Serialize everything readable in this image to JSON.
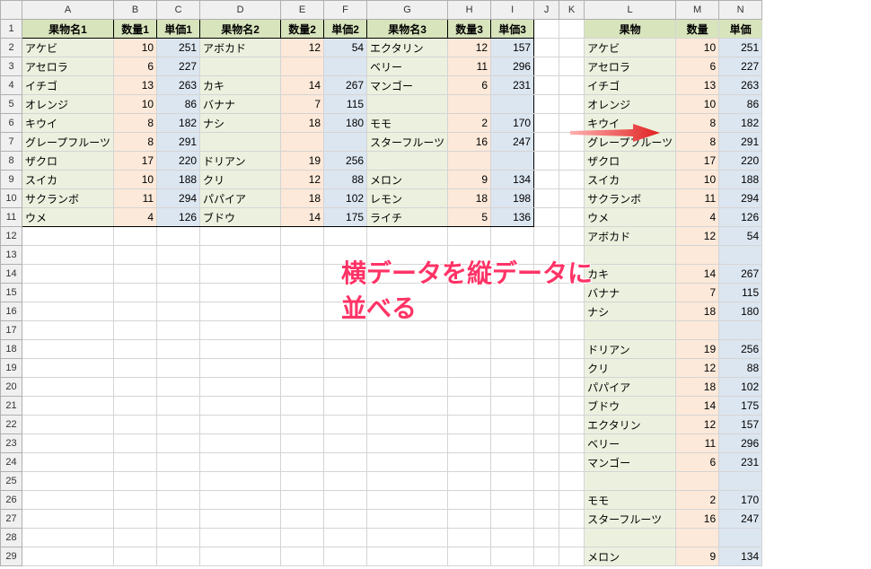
{
  "cols": [
    "A",
    "B",
    "C",
    "D",
    "E",
    "F",
    "G",
    "H",
    "I",
    "J",
    "K",
    "L",
    "M",
    "N"
  ],
  "widths": [
    90,
    48,
    48,
    90,
    48,
    48,
    90,
    48,
    48,
    28,
    28,
    90,
    48,
    48
  ],
  "headers1": {
    "A": "果物名1",
    "B": "数量1",
    "C": "単価1",
    "D": "果物名2",
    "E": "数量2",
    "F": "単価2",
    "G": "果物名3",
    "H": "数量3",
    "I": "単価3"
  },
  "headersR": {
    "L": "果物",
    "M": "数量",
    "N": "単価"
  },
  "left": [
    {
      "a": "アケビ",
      "b": 10,
      "c": 251,
      "d": "アボカド",
      "e": 12,
      "f": 54,
      "g": "エクタリン",
      "h": 12,
      "i": 157
    },
    {
      "a": "アセロラ",
      "b": 6,
      "c": 227,
      "d": "",
      "e": "",
      "f": "",
      "g": "ベリー",
      "h": 11,
      "i": 296
    },
    {
      "a": "イチゴ",
      "b": 13,
      "c": 263,
      "d": "カキ",
      "e": 14,
      "f": 267,
      "g": "マンゴー",
      "h": 6,
      "i": 231
    },
    {
      "a": "オレンジ",
      "b": 10,
      "c": 86,
      "d": "バナナ",
      "e": 7,
      "f": 115,
      "g": "",
      "h": "",
      "i": ""
    },
    {
      "a": "キウイ",
      "b": 8,
      "c": 182,
      "d": "ナシ",
      "e": 18,
      "f": 180,
      "g": "モモ",
      "h": 2,
      "i": 170
    },
    {
      "a": "グレープフルーツ",
      "b": 8,
      "c": 291,
      "d": "",
      "e": "",
      "f": "",
      "g": "スターフルーツ",
      "h": 16,
      "i": 247
    },
    {
      "a": "ザクロ",
      "b": 17,
      "c": 220,
      "d": "ドリアン",
      "e": 19,
      "f": 256,
      "g": "",
      "h": "",
      "i": ""
    },
    {
      "a": "スイカ",
      "b": 10,
      "c": 188,
      "d": "クリ",
      "e": 12,
      "f": 88,
      "g": "メロン",
      "h": 9,
      "i": 134
    },
    {
      "a": "サクランボ",
      "b": 11,
      "c": 294,
      "d": "パパイア",
      "e": 18,
      "f": 102,
      "g": "レモン",
      "h": 18,
      "i": 198
    },
    {
      "a": "ウメ",
      "b": 4,
      "c": 126,
      "d": "ブドウ",
      "e": 14,
      "f": 175,
      "g": "ライチ",
      "h": 5,
      "i": 136
    }
  ],
  "right": [
    {
      "l": "アケビ",
      "m": 10,
      "n": 251
    },
    {
      "l": "アセロラ",
      "m": 6,
      "n": 227
    },
    {
      "l": "イチゴ",
      "m": 13,
      "n": 263
    },
    {
      "l": "オレンジ",
      "m": 10,
      "n": 86
    },
    {
      "l": "キウイ",
      "m": 8,
      "n": 182
    },
    {
      "l": "グレープフルーツ",
      "m": 8,
      "n": 291
    },
    {
      "l": "ザクロ",
      "m": 17,
      "n": 220
    },
    {
      "l": "スイカ",
      "m": 10,
      "n": 188
    },
    {
      "l": "サクランボ",
      "m": 11,
      "n": 294
    },
    {
      "l": "ウメ",
      "m": 4,
      "n": 126
    },
    {
      "l": "アボカド",
      "m": 12,
      "n": 54
    },
    {
      "l": "",
      "m": "",
      "n": ""
    },
    {
      "l": "カキ",
      "m": 14,
      "n": 267
    },
    {
      "l": "バナナ",
      "m": 7,
      "n": 115
    },
    {
      "l": "ナシ",
      "m": 18,
      "n": 180
    },
    {
      "l": "",
      "m": "",
      "n": ""
    },
    {
      "l": "ドリアン",
      "m": 19,
      "n": 256
    },
    {
      "l": "クリ",
      "m": 12,
      "n": 88
    },
    {
      "l": "パパイア",
      "m": 18,
      "n": 102
    },
    {
      "l": "ブドウ",
      "m": 14,
      "n": 175
    },
    {
      "l": "エクタリン",
      "m": 12,
      "n": 157
    },
    {
      "l": "ベリー",
      "m": 11,
      "n": 296
    },
    {
      "l": "マンゴー",
      "m": 6,
      "n": 231
    },
    {
      "l": "",
      "m": "",
      "n": ""
    },
    {
      "l": "モモ",
      "m": 2,
      "n": 170
    },
    {
      "l": "スターフルーツ",
      "m": 16,
      "n": 247
    },
    {
      "l": "",
      "m": "",
      "n": ""
    },
    {
      "l": "メロン",
      "m": 9,
      "n": 134
    }
  ],
  "annotation": {
    "line1": "横データを縦データに",
    "line2": "並べる"
  }
}
